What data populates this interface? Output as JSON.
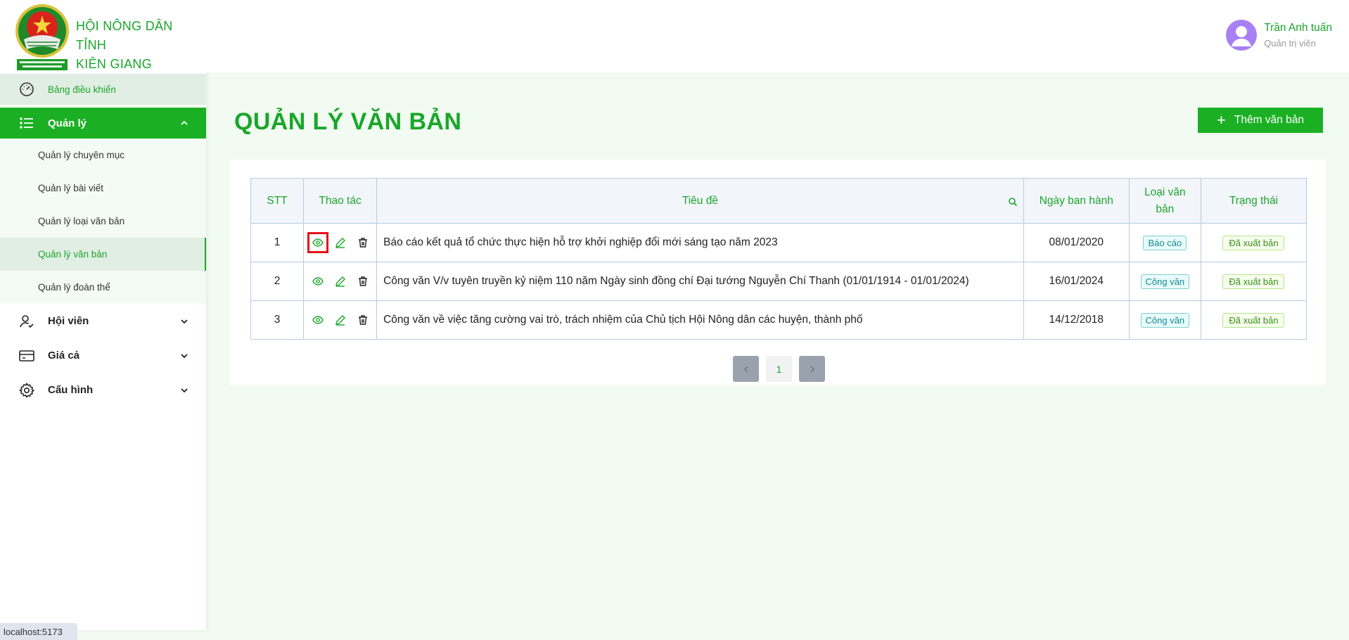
{
  "brand": {
    "line1": "HỘI NÔNG DÂN TỈNH",
    "line2": "KIÊN GIANG"
  },
  "sidebar": {
    "dashboard": "Bảng điều khiển",
    "manage": "Quản lý",
    "sub_items": [
      "Quản lý chuyên mục",
      "Quản lý bài viết",
      "Quản lý loại văn bản",
      "Quản lý văn bản",
      "Quản lý đoàn thể"
    ],
    "groups": [
      "Hội viên",
      "Giá cả",
      "Cấu hình"
    ]
  },
  "user": {
    "name": "Trần Anh tuấn",
    "role": "Quản trị viên"
  },
  "page": {
    "title": "QUẢN LÝ VĂN BẢN",
    "add_label": "Thêm văn bản"
  },
  "table": {
    "headers": [
      "STT",
      "Thao tác",
      "Tiêu đề",
      "Ngày ban hành",
      "Loại văn bản",
      "Trạng thái"
    ],
    "rows": [
      {
        "stt": "1",
        "title": "Báo cáo kết quả tổ chức thực hiện hỗ trợ khởi nghiệp đổi mới sáng tạo năm 2023",
        "date": "08/01/2020",
        "type": "Báo cáo",
        "status": "Đã xuất bản"
      },
      {
        "stt": "2",
        "title": "Công văn V/v tuyên truyền kỷ niệm 110 năm Ngày sinh đồng chí Đại tướng Nguyễn Chí Thanh (01/01/1914 - 01/01/2024)",
        "date": "16/01/2024",
        "type": "Công văn",
        "status": "Đã xuất bản"
      },
      {
        "stt": "3",
        "title": "Công văn về việc tăng cường vai trò, trách nhiệm của Chủ tịch Hội Nông dân các huyện, thành phố",
        "date": "14/12/2018",
        "type": "Công văn",
        "status": "Đã xuất bản"
      }
    ]
  },
  "pagination": {
    "current": "1"
  },
  "statusbar": {
    "url": "localhost:5173"
  },
  "colors": {
    "accent": "#1aa62a",
    "accent_bg": "#1bb024",
    "highlight": "#e5121b"
  }
}
